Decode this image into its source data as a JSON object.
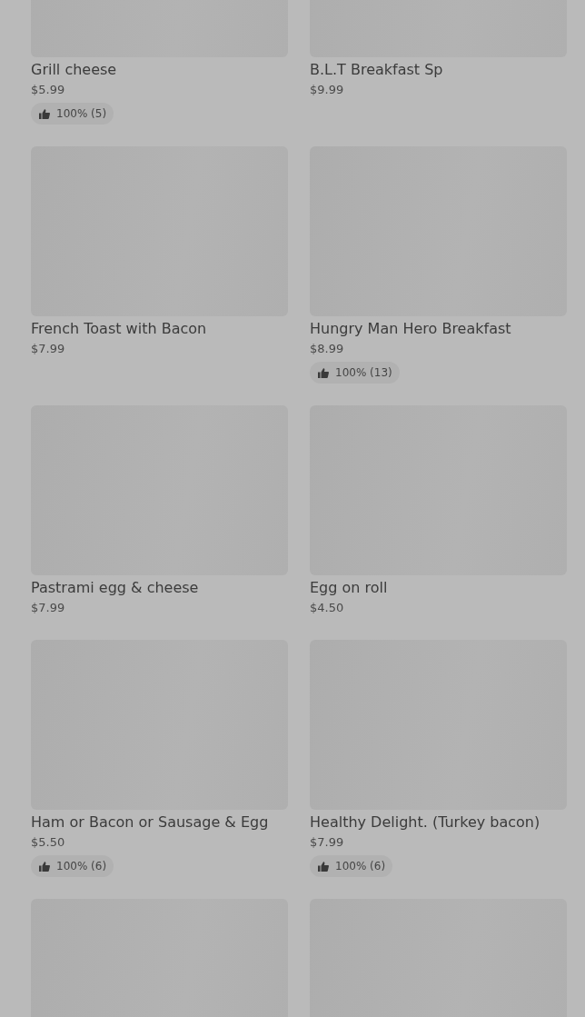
{
  "items": [
    {
      "kind": "dish",
      "name": "Grill cheese",
      "price": "$5.99",
      "rating": "100% (5)"
    },
    {
      "kind": "dish",
      "name": "B.L.T Breakfast Sp",
      "price": "$9.99"
    },
    {
      "kind": "dish",
      "name": "French Toast with Bacon",
      "price": "$7.99"
    },
    {
      "kind": "dish",
      "name": "Hungry Man Hero Breakfast",
      "price": "$8.99",
      "rating": "100% (13)"
    },
    {
      "kind": "dish",
      "name": "Pastrami egg & cheese",
      "price": "$7.99"
    },
    {
      "kind": "dish",
      "name": "Egg on roll",
      "price": "$4.50"
    },
    {
      "kind": "dish",
      "name": "Ham or Bacon or Sausage & Egg",
      "price": "$5.50",
      "rating": "100% (6)"
    },
    {
      "kind": "dish",
      "name": "Healthy Delight. (Turkey bacon)",
      "price": "$7.99",
      "rating": "100% (6)"
    },
    {
      "kind": "picture"
    },
    {
      "kind": "picture"
    }
  ]
}
